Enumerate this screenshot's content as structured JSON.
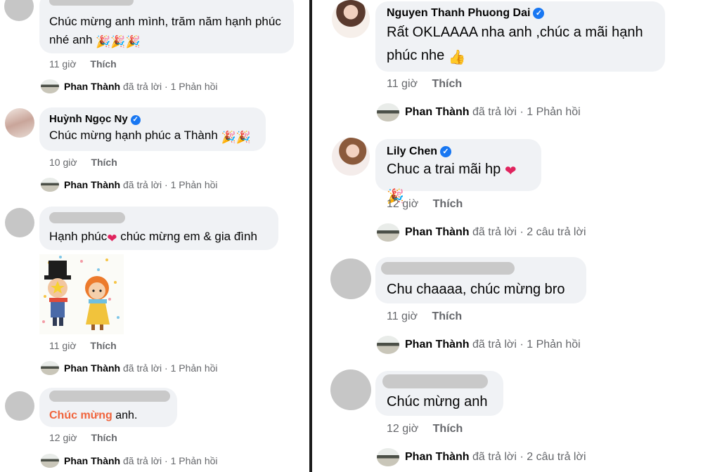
{
  "left": {
    "comments": [
      {
        "text": "Chúc mừng anh mình, trăm năm hạnh phúc nhé anh",
        "time": "11 giờ",
        "like": "Thích",
        "reply": {
          "name": "Phan Thành",
          "action": "đã trả lời",
          "dot": "·",
          "count": "1 Phản hồi"
        }
      },
      {
        "name": "Huỳnh Ngọc Ny",
        "text": "Chúc mừng hạnh phúc a Thành",
        "time": "10 giờ",
        "like": "Thích",
        "reply": {
          "name": "Phan Thành",
          "action": "đã trả lời",
          "dot": "·",
          "count": "1 Phản hồi"
        }
      },
      {
        "text_a": "Hạnh phúc",
        "text_b": " chúc mừng em & gia đình",
        "time": "11 giờ",
        "like": "Thích",
        "reply": {
          "name": "Phan Thành",
          "action": "đã trả lời",
          "dot": "·",
          "count": "1 Phản hồi"
        }
      },
      {
        "text_highlight": "Chúc mừng",
        "text_rest": " anh.",
        "time": "12 giờ",
        "like": "Thích",
        "reply": {
          "name": "Phan Thành",
          "action": "đã trả lời",
          "dot": "·",
          "count": "1 Phản hồi"
        }
      }
    ]
  },
  "right": {
    "comments": [
      {
        "name": "Nguyen Thanh Phuong Dai",
        "text": "Rất OKLAAAA nha anh ,chúc a mãi hạnh phúc nhe",
        "time": "11 giờ",
        "like": "Thích",
        "reply": {
          "name": "Phan Thành",
          "action": "đã trả lời",
          "dot": "·",
          "count": "1 Phản hồi"
        }
      },
      {
        "name": "Lily Chen",
        "text": "Chuc a trai mãi hp",
        "time": "12 giờ",
        "like": "Thích",
        "reply": {
          "name": "Phan Thành",
          "action": "đã trả lời",
          "dot": "·",
          "count": "2 câu trả lời"
        }
      },
      {
        "text": "Chu chaaaa, chúc mừng bro",
        "time": "11 giờ",
        "like": "Thích",
        "reply": {
          "name": "Phan Thành",
          "action": "đã trả lời",
          "dot": "·",
          "count": "1 Phản hồi"
        }
      },
      {
        "text": "Chúc mừng anh",
        "time": "12 giờ",
        "like": "Thích",
        "reply": {
          "name": "Phan Thành",
          "action": "đã trả lời",
          "dot": "·",
          "count": "2 câu trả lời"
        }
      }
    ]
  },
  "icons": {
    "verified": "✓",
    "heart": "❤",
    "party": "🎉",
    "thumbs_up": "👍"
  },
  "colors": {
    "bubble": "#f0f2f5",
    "meta": "#65676b",
    "verified": "#1877f2",
    "highlight": "#f0643c",
    "heart": "#e0245e"
  }
}
